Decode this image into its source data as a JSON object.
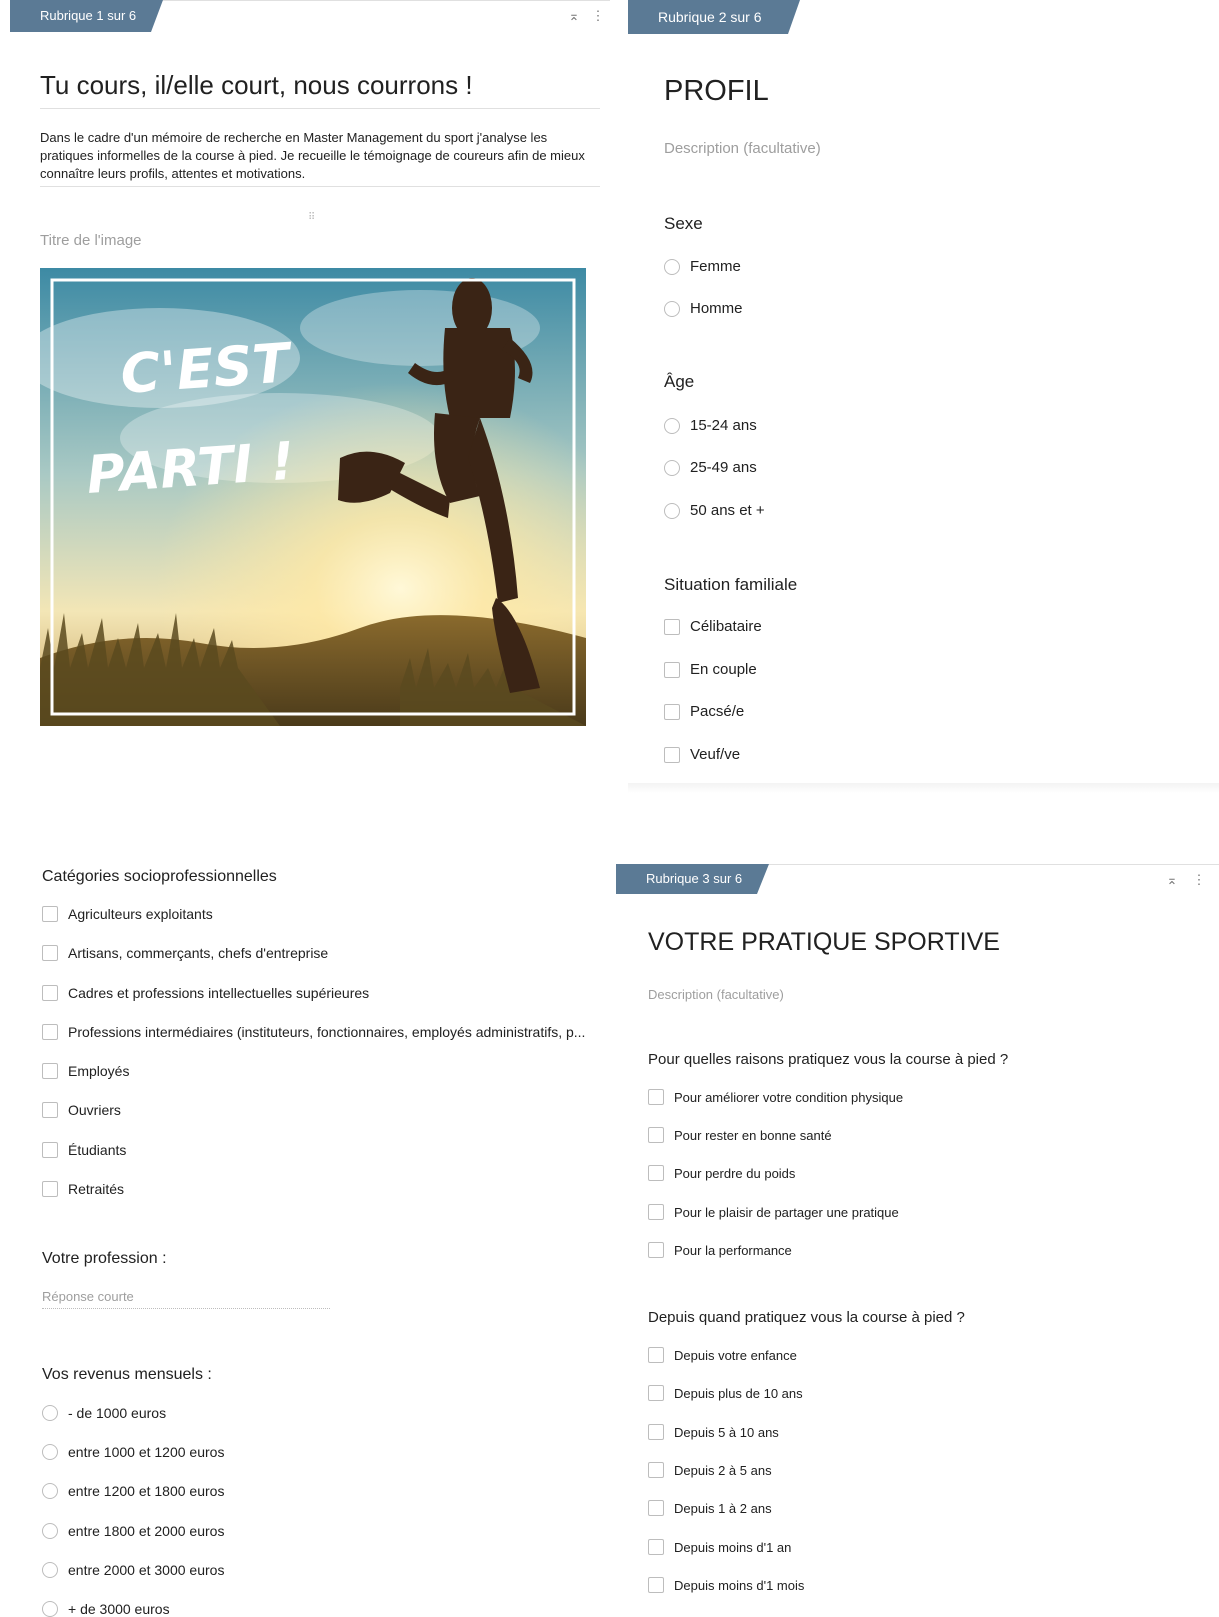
{
  "section1": {
    "tab_label": "Rubrique 1 sur 6",
    "title": "Tu cours, il/elle court, nous courrons !",
    "description": "Dans le cadre d'un mémoire de recherche en Master Management du sport j'analyse les pratiques informelles de la course à pied. Je recueille le témoignage de coureurs afin de mieux connaître leurs profils, attentes et motivations.",
    "image_title_placeholder": "Titre de l'image",
    "image_text_line1": "C'EST",
    "image_text_line2": "PARTI !"
  },
  "section2": {
    "tab_label": "Rubrique 2 sur 6",
    "title": "PROFIL",
    "description_placeholder": "Description (facultative)",
    "sexe": {
      "title": "Sexe",
      "options": [
        "Femme",
        "Homme"
      ]
    },
    "age": {
      "title": "Âge",
      "options": [
        "15-24 ans",
        "25-49 ans",
        "50 ans et +"
      ]
    },
    "situation": {
      "title": "Situation familiale",
      "options": [
        "Célibataire",
        "En couple",
        "Pacsé/e",
        "Veuf/ve"
      ]
    }
  },
  "section2b": {
    "csp": {
      "title": "Catégories socioprofessionnelles",
      "options": [
        "Agriculteurs exploitants",
        "Artisans, commerçants, chefs d'entreprise",
        "Cadres et professions intellectuelles supérieures",
        "Professions intermédiaires (instituteurs, fonctionnaires, employés administratifs, p...",
        "Employés",
        "Ouvriers",
        "Étudiants",
        "Retraités"
      ]
    },
    "profession": {
      "title": "Votre profession :",
      "placeholder": "Réponse courte"
    },
    "revenus": {
      "title": "Vos revenus mensuels :",
      "options": [
        "- de 1000 euros",
        "entre 1000 et 1200 euros",
        "entre 1200 et 1800 euros",
        "entre 1800 et 2000 euros",
        "entre 2000 et 3000 euros",
        "+ de 3000 euros"
      ]
    }
  },
  "section3": {
    "tab_label": "Rubrique 3 sur 6",
    "title": "VOTRE PRATIQUE SPORTIVE",
    "description_placeholder": "Description (facultative)",
    "raisons": {
      "title": "Pour quelles raisons pratiquez vous la course à pied ?",
      "options": [
        "Pour améliorer votre condition physique",
        "Pour rester en bonne santé",
        "Pour perdre du poids",
        "Pour le plaisir de partager une pratique",
        "Pour la performance"
      ]
    },
    "depuis": {
      "title": "Depuis quand pratiquez vous la course à pied ?",
      "options": [
        "Depuis votre enfance",
        "Depuis plus de 10 ans",
        "Depuis 5 à 10 ans",
        "Depuis 2 à 5 ans",
        "Depuis 1 à 2 ans",
        "Depuis moins d'1 an",
        "Depuis moins d'1 mois"
      ]
    }
  },
  "icons": {
    "collapse": "collapse-icon",
    "more": "more-vert-icon",
    "drag": "drag-handle-icon"
  },
  "colors": {
    "tab": "#5b7a95",
    "hint": "#9e9e9e",
    "border": "#bdbdbd"
  }
}
